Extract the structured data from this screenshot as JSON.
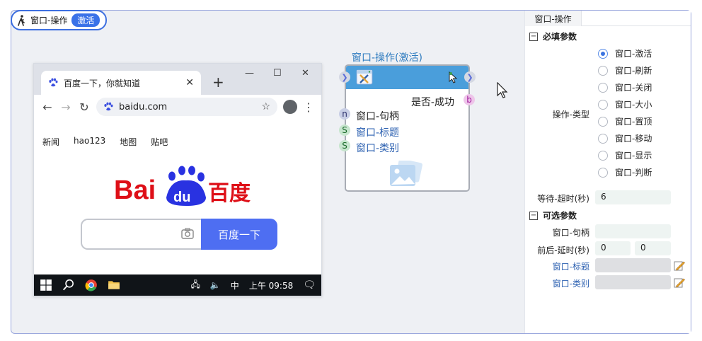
{
  "header": {
    "title": "窗口-操作",
    "badge": "激活"
  },
  "browser": {
    "tab_title": "百度一下，你就知道",
    "tab_close": "✕",
    "new_tab": "+",
    "window_controls": [
      "—",
      "☐",
      "✕"
    ],
    "url": "baidu.com",
    "nav_links": [
      "新闻",
      "hao123",
      "地图",
      "贴吧"
    ],
    "search_button": "百度一下",
    "taskbar": {
      "ime": "中",
      "clock": "上午 09:58"
    }
  },
  "node": {
    "title": "窗口-操作(激活)",
    "output": {
      "label": "是否-成功",
      "pin": "b"
    },
    "inputs": [
      {
        "pin": "n",
        "label": "窗口-句柄"
      },
      {
        "pin": "S",
        "label": "窗口-标题"
      },
      {
        "pin": "S",
        "label": "窗口-类别"
      }
    ]
  },
  "panel": {
    "tab": "窗口-操作",
    "required_section": "必填参数",
    "op_type_label": "操作-类型",
    "op_options": [
      "窗口-激活",
      "窗口-刷新",
      "窗口-关闭",
      "窗口-大小",
      "窗口-置顶",
      "窗口-移动",
      "窗口-显示",
      "窗口-判断"
    ],
    "selected_option": "窗口-激活",
    "timeout_label": "等待-超时(秒)",
    "timeout_value": "6",
    "optional_section": "可选参数",
    "handle_label": "窗口-句柄",
    "handle_value": "",
    "delay_label": "前后-延时(秒)",
    "delay_before": "0",
    "delay_after": "0",
    "title_label": "窗口-标题",
    "class_label": "窗口-类别"
  },
  "colors": {
    "accent": "#3a72e8",
    "node_header": "#4a9edb",
    "baidu_red": "#de0f17",
    "baidu_blue": "#2932e1",
    "search_button": "#4e6ef2"
  }
}
